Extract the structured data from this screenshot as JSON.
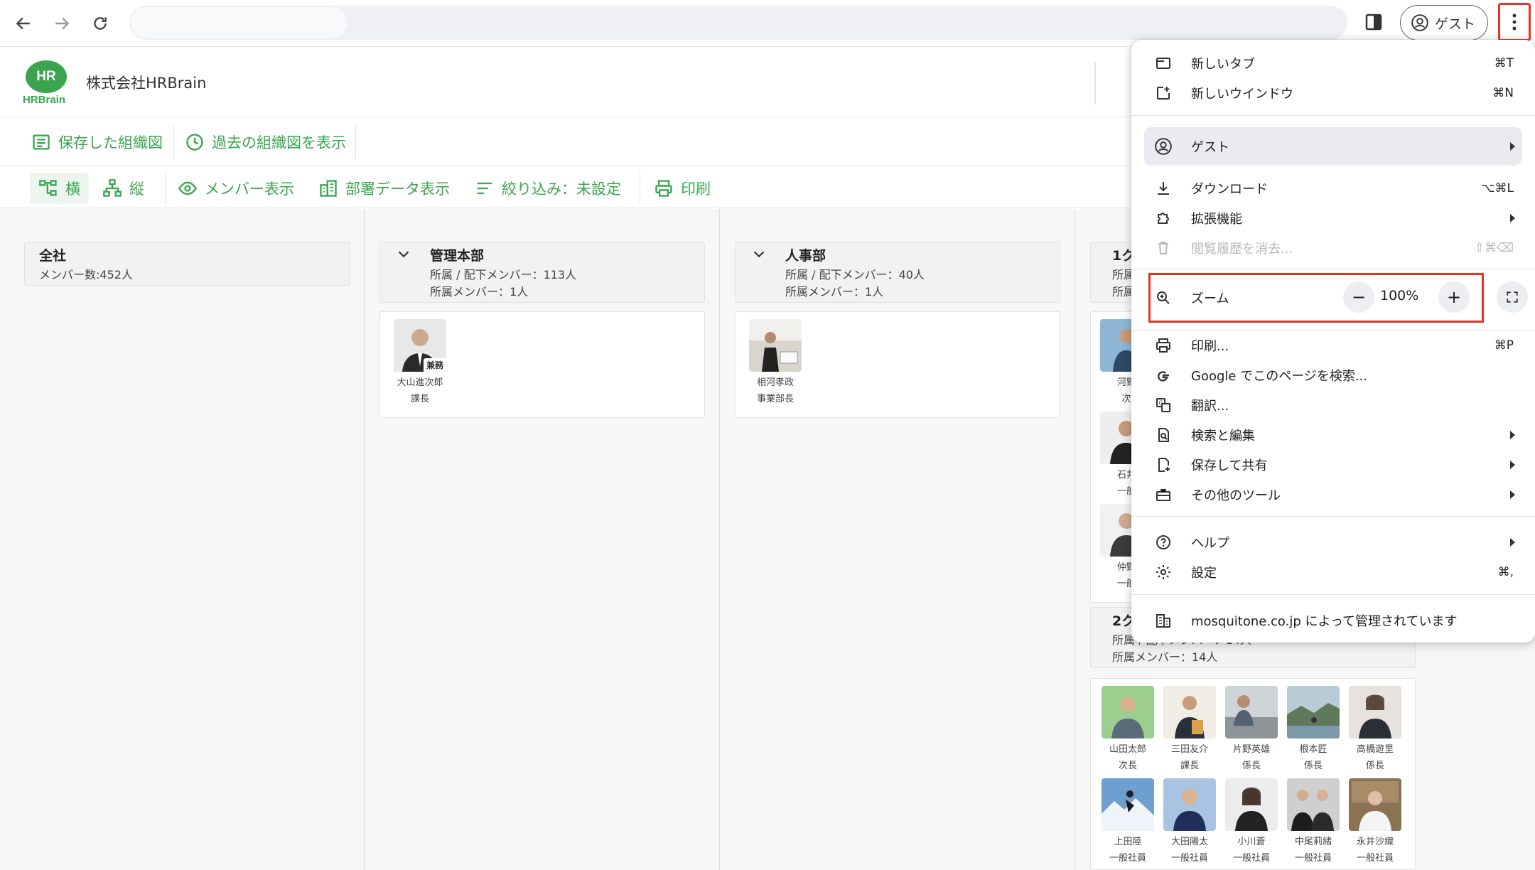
{
  "browser": {
    "guest_label": "ゲスト"
  },
  "app": {
    "logo_bubble": "HR",
    "logo_text": "HRBrain",
    "company_name": "株式会社HRBrain",
    "toolbar1": {
      "saved_charts": "保存した組織図",
      "past_charts": "過去の組織図を表示"
    },
    "toolbar2": {
      "horizontal": "横",
      "vertical": "縦",
      "member_display": "メンバー表示",
      "dept_data": "部署データ表示",
      "filter": "絞り込み：未設定",
      "print": "印刷"
    }
  },
  "org": {
    "root": {
      "title": "全社",
      "meta": "メンバー数:452人"
    },
    "depts": [
      {
        "title": "管理本部",
        "meta1": "所属 / 配下メンバー：113人",
        "meta2": "所属メンバー：1人",
        "members": [
          {
            "name": "大山進次郎",
            "role": "課長",
            "badge": "兼務"
          }
        ]
      },
      {
        "title": "人事部",
        "meta1": "所属 / 配下メンバー：40人",
        "meta2": "所属メンバー：1人",
        "members": [
          {
            "name": "相河孝政",
            "role": "事業部長"
          }
        ]
      },
      {
        "title": "1ク",
        "meta1": "所属",
        "meta2": "所属",
        "members": [
          {
            "name": "河野",
            "role": "次"
          },
          {
            "name": "石井",
            "role": "一般"
          },
          {
            "name": "仲野",
            "role": "一般"
          }
        ]
      },
      {
        "title": "2ク",
        "meta1": "所属 / 配下メンバー：14人",
        "meta2": "所属メンバー：14人",
        "members": [
          {
            "name": "山田太郎",
            "role": "次長"
          },
          {
            "name": "三田友介",
            "role": "課長"
          },
          {
            "name": "片野英雄",
            "role": "係長"
          },
          {
            "name": "根本匠",
            "role": "係長"
          },
          {
            "name": "高橋遊里",
            "role": "係長"
          },
          {
            "name": "上田陸",
            "role": "一般社員"
          },
          {
            "name": "大田陽太",
            "role": "一般社員"
          },
          {
            "name": "小川蒼",
            "role": "一般社員"
          },
          {
            "name": "中尾莉緒",
            "role": "一般社員"
          },
          {
            "name": "永井沙織",
            "role": "一般社員"
          }
        ]
      }
    ]
  },
  "menu": {
    "new_tab": {
      "label": "新しいタブ",
      "shortcut": "⌘T"
    },
    "new_window": {
      "label": "新しいウインドウ",
      "shortcut": "⌘N"
    },
    "guest": {
      "label": "ゲスト"
    },
    "downloads": {
      "label": "ダウンロード",
      "shortcut": "⌥⌘L"
    },
    "extensions": {
      "label": "拡張機能"
    },
    "clear_history": {
      "label": "閲覧履歴を消去...",
      "shortcut": "⇧⌘⌫"
    },
    "zoom": {
      "label": "ズーム",
      "value": "100%",
      "minus": "−",
      "plus": "+"
    },
    "print": {
      "label": "印刷...",
      "shortcut": "⌘P"
    },
    "google_search": {
      "label": "Google でこのページを検索..."
    },
    "translate": {
      "label": "翻訳..."
    },
    "search_edit": {
      "label": "検索と編集"
    },
    "save_share": {
      "label": "保存して共有"
    },
    "more_tools": {
      "label": "その他のツール"
    },
    "help": {
      "label": "ヘルプ"
    },
    "settings": {
      "label": "設定",
      "shortcut": "⌘,"
    },
    "managed": {
      "label": "mosquitone.co.jp によって管理されています"
    }
  },
  "colors": {
    "brand_green": "#3aa54e",
    "highlight_red": "#e53323"
  }
}
